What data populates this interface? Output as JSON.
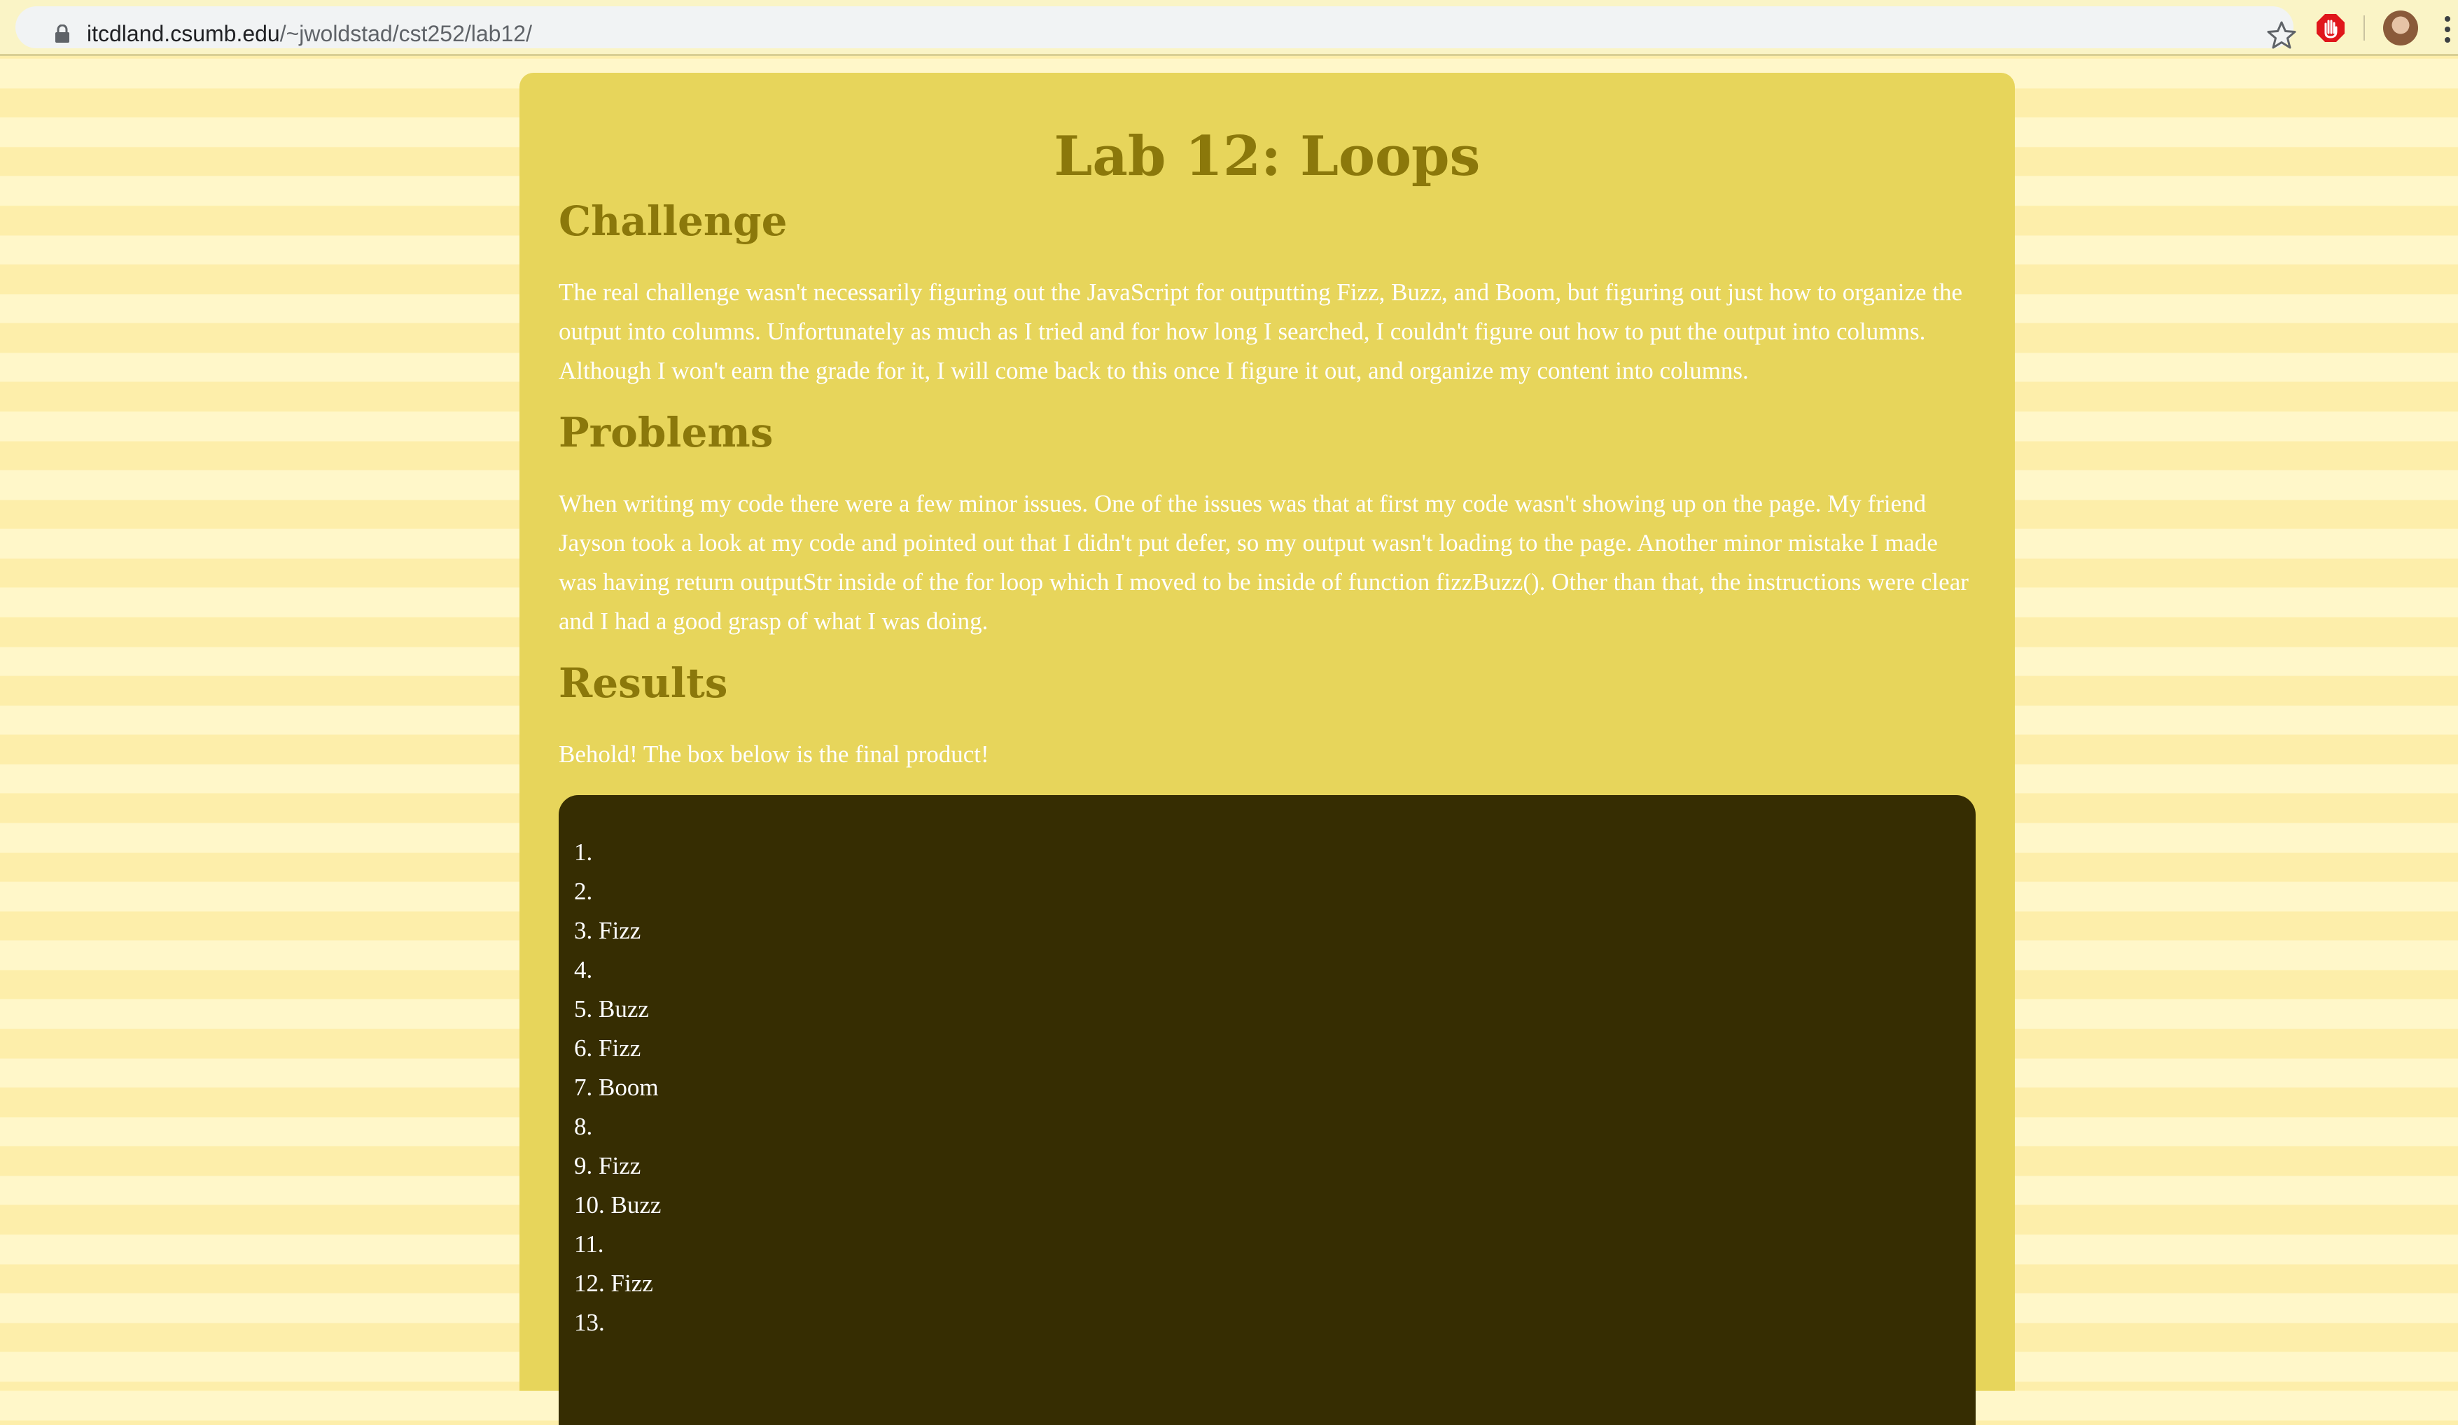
{
  "browser": {
    "url_host": "itcdland.csumb.edu",
    "url_path": "/~jwoldstad/cst252/lab12/"
  },
  "page": {
    "title": "Lab 12: Loops",
    "sections": {
      "challenge": {
        "heading": "Challenge",
        "text": "The real challenge wasn't necessarily figuring out the JavaScript for outputting Fizz, Buzz, and Boom, but figuring out just how to organize the output into columns. Unfortunately as much as I tried and for how long I searched, I couldn't figure out how to put the output into columns. Although I won't earn the grade for it, I will come back to this once I figure it out, and organize my content into columns."
      },
      "problems": {
        "heading": "Problems",
        "text": "When writing my code there were a few minor issues. One of the issues was that at first my code wasn't showing up on the page. My friend Jayson took a look at my code and pointed out that I didn't put defer, so my output wasn't loading to the page. Another minor mistake I made was having return outputStr inside of the for loop which I moved to be inside of function fizzBuzz(). Other than that, the instructions were clear and I had a good grasp of what I was doing."
      },
      "results": {
        "heading": "Results",
        "text": "Behold! The box below is the final product!"
      }
    },
    "output_lines": [
      "1.",
      "2.",
      "3. Fizz",
      "4.",
      "5. Buzz",
      "6. Fizz",
      "7. Boom",
      "8.",
      "9. Fizz",
      "10. Buzz",
      "11.",
      "12. Fizz",
      "13."
    ]
  },
  "colors": {
    "card_background": "#e7d55b",
    "heading_color": "#8b780b",
    "output_background": "#362d02",
    "body_text": "#ffffff"
  },
  "icons": {
    "address_bar": [
      "lock-icon",
      "star-icon"
    ],
    "toolbar": [
      "extension-stop-icon",
      "profile-avatar",
      "more-menu-icon"
    ]
  }
}
